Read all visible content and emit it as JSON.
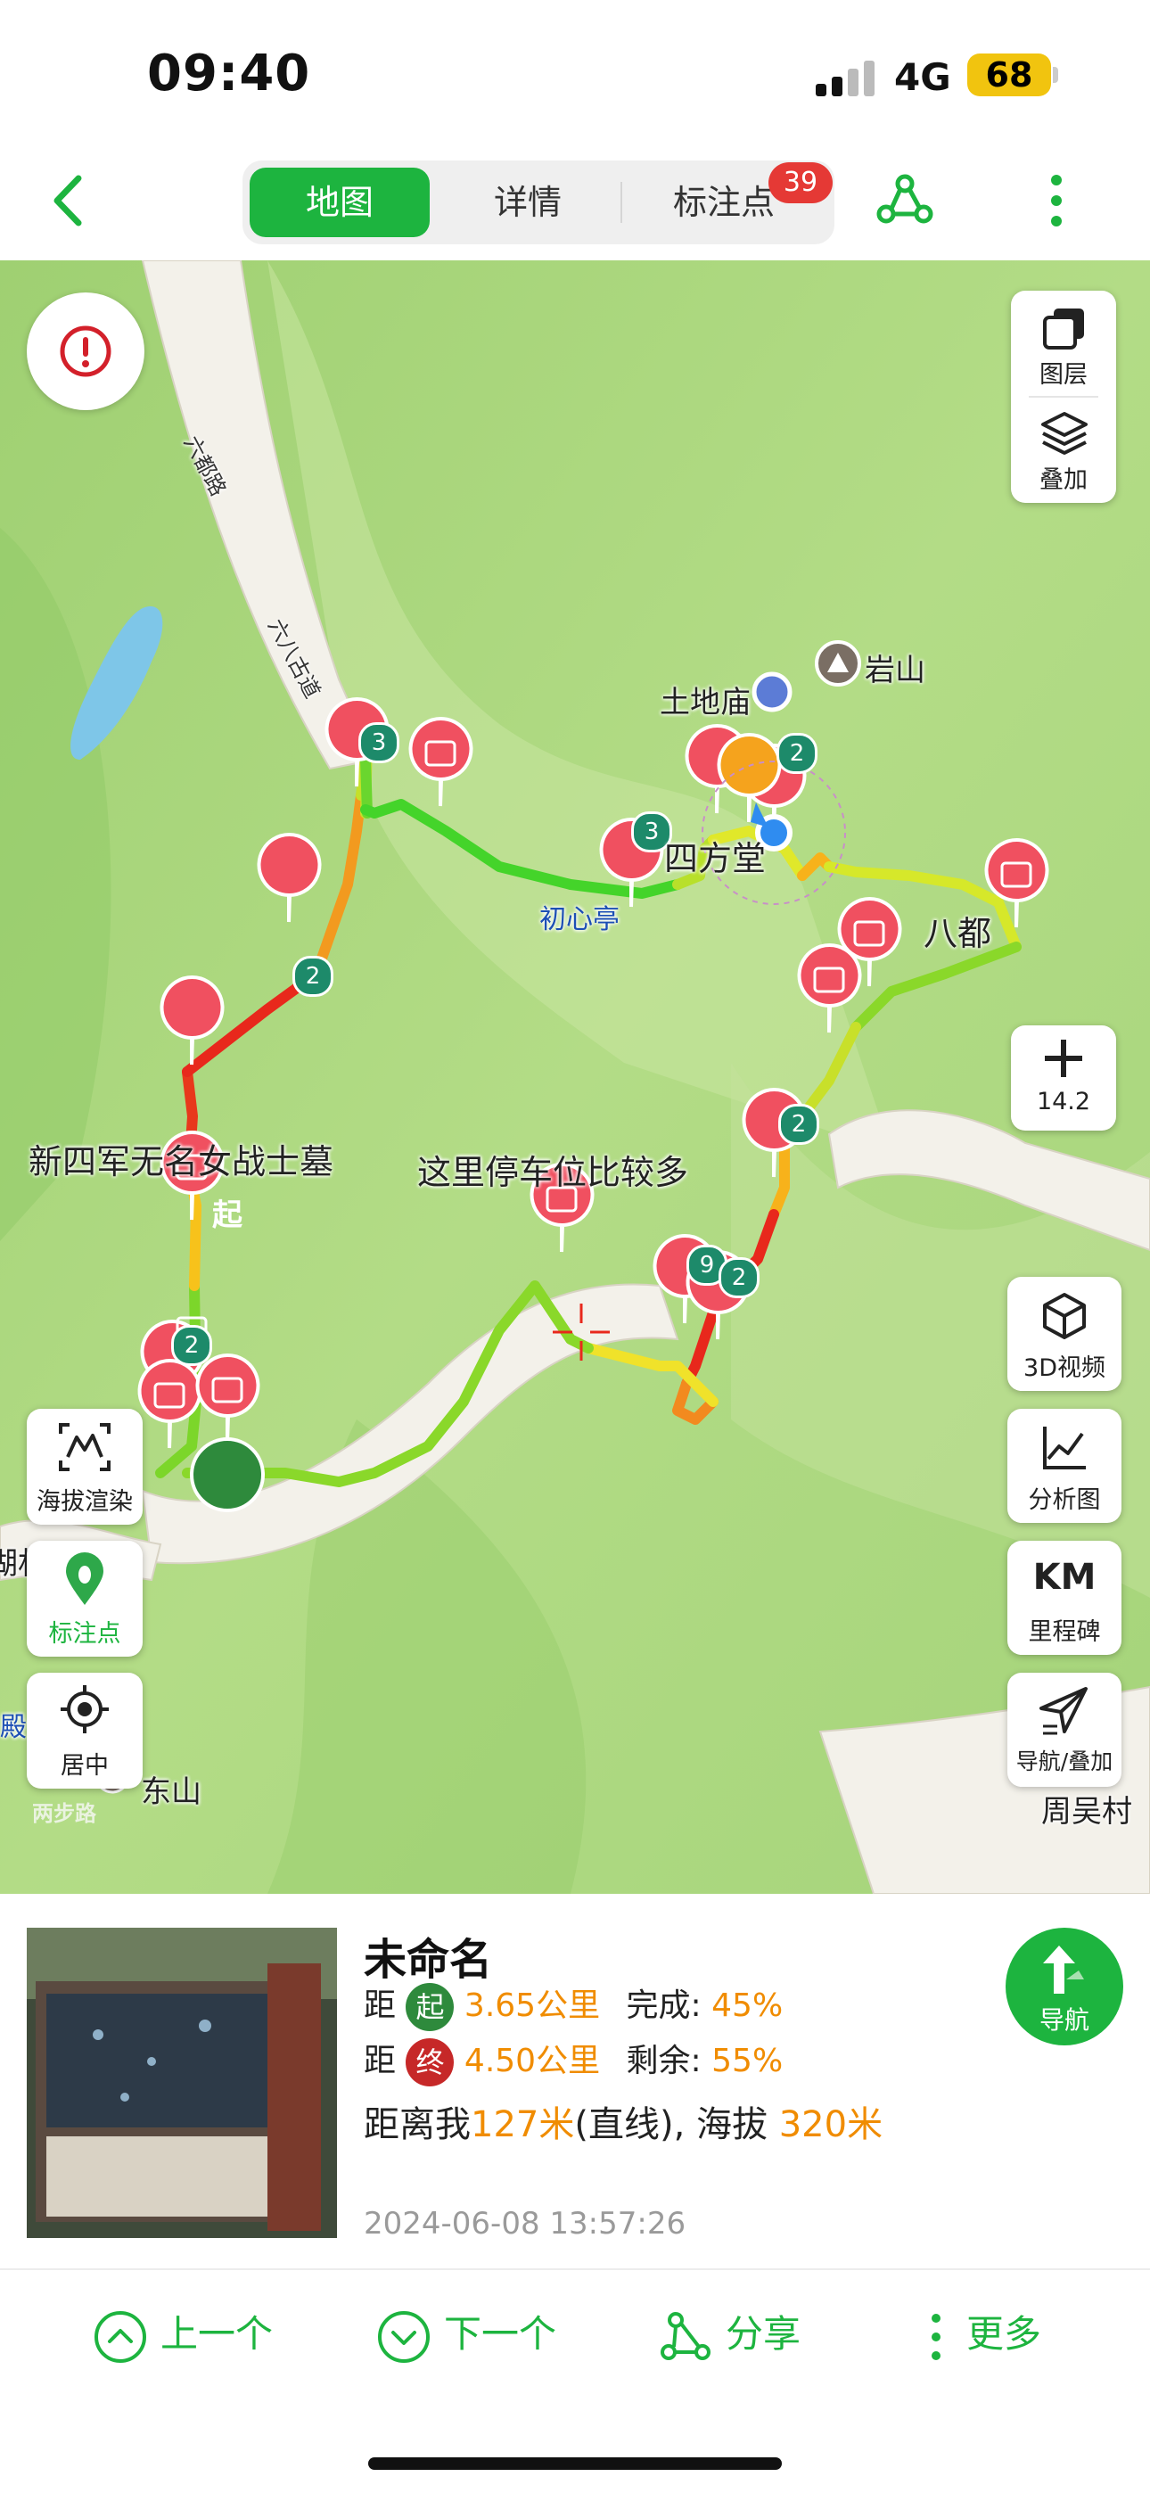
{
  "status": {
    "time": "09:40",
    "network": "4G",
    "battery": "68"
  },
  "nav": {
    "tabs": [
      "地图",
      "详情",
      "标注点"
    ],
    "marks_badge": "39",
    "active_tab": "地图"
  },
  "map": {
    "labels": {
      "tudimiao": "土地庙",
      "yanshan": "岩山",
      "sifangtang": "四方堂",
      "chuxinting": "初心亭",
      "badu": "八都",
      "liudulu": "六都路",
      "liubagudao": "六八古道",
      "tomb_note": "新四军无名女战士墓",
      "parking_note": "这里停车位比较多",
      "dongshan": "东山",
      "zhouwucun": "周吴村",
      "left_edge_1": "湖村",
      "left_edge_2": "殿",
      "watermark": "两步路"
    },
    "cluster_counts": [
      "3",
      "2",
      "3",
      "2",
      "2",
      "2",
      "9",
      "2"
    ],
    "start_label": "起",
    "buttons": {
      "layers": "图层",
      "overlay": "叠加",
      "zoom_value": "14.2",
      "video3d": "3D视频",
      "analysis": "分析图",
      "km_icon": "KM",
      "milestone": "里程碑",
      "nav_overlay": "导航/叠加",
      "elevation": "海拔渲染",
      "marks": "标注点",
      "center": "居中"
    }
  },
  "info": {
    "title": "未命名",
    "dist_start_prefix": "距",
    "start_badge": "起",
    "dist_start": "3.65公里",
    "done_label": "完成:",
    "done_value": "45%",
    "dist_end_prefix": "距",
    "end_badge": "终",
    "dist_end": "4.50公里",
    "left_label": "剩余:",
    "left_value": "55%",
    "me_prefix": "距离我",
    "me_value": "127米",
    "me_suffix": "(直线), 海拔",
    "altitude": "320米",
    "timestamp": "2024-06-08 13:57:26",
    "nav_button": "导航",
    "progress_done": 0.45
  },
  "bottom_bar": {
    "prev": "上一个",
    "next": "下一个",
    "share": "分享",
    "more": "更多"
  },
  "colors": {
    "accent": "#1db43f",
    "badge_red": "#e53935",
    "highlight": "#f08c00",
    "marker": "#f05060",
    "cluster": "#1d8a6a"
  }
}
